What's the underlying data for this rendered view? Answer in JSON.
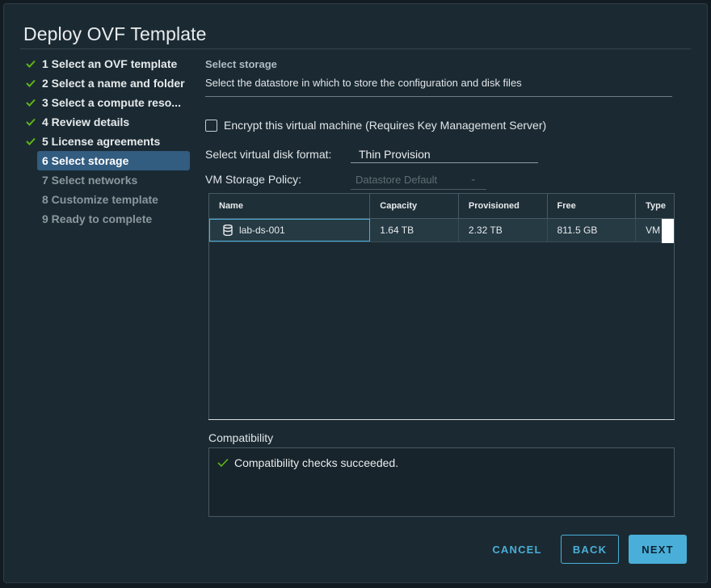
{
  "dialog": {
    "title": "Deploy OVF Template"
  },
  "steps": [
    {
      "label": "1 Select an OVF template",
      "state": "done"
    },
    {
      "label": "2 Select a name and folder",
      "state": "done"
    },
    {
      "label": "3 Select a compute reso...",
      "state": "done"
    },
    {
      "label": "4 Review details",
      "state": "done"
    },
    {
      "label": "5 License agreements",
      "state": "done"
    },
    {
      "label": "6 Select storage",
      "state": "active"
    },
    {
      "label": "7 Select networks",
      "state": "pending"
    },
    {
      "label": "8 Customize template",
      "state": "pending"
    },
    {
      "label": "9 Ready to complete",
      "state": "pending"
    }
  ],
  "main": {
    "section_title": "Select storage",
    "section_desc": "Select the datastore in which to store the configuration and disk files",
    "encrypt_label": "Encrypt this virtual machine (Requires Key Management Server)",
    "disk_format_label": "Select virtual disk format:",
    "disk_format_value": "Thin Provision",
    "policy_label": "VM Storage Policy:",
    "policy_value": "Datastore Default"
  },
  "grid": {
    "columns": [
      "Name",
      "Capacity",
      "Provisioned",
      "Free",
      "Type"
    ],
    "rows": [
      {
        "name": "lab-ds-001",
        "capacity": "1.64 TB",
        "provisioned": "2.32 TB",
        "free": "811.5 GB",
        "type": "VM"
      }
    ]
  },
  "compatibility": {
    "title": "Compatibility",
    "message": "Compatibility checks succeeded."
  },
  "buttons": {
    "cancel": "CANCEL",
    "back": "BACK",
    "next": "NEXT"
  },
  "colors": {
    "accent": "#49afd9",
    "success": "#60b515",
    "active_step": "#325c80"
  }
}
